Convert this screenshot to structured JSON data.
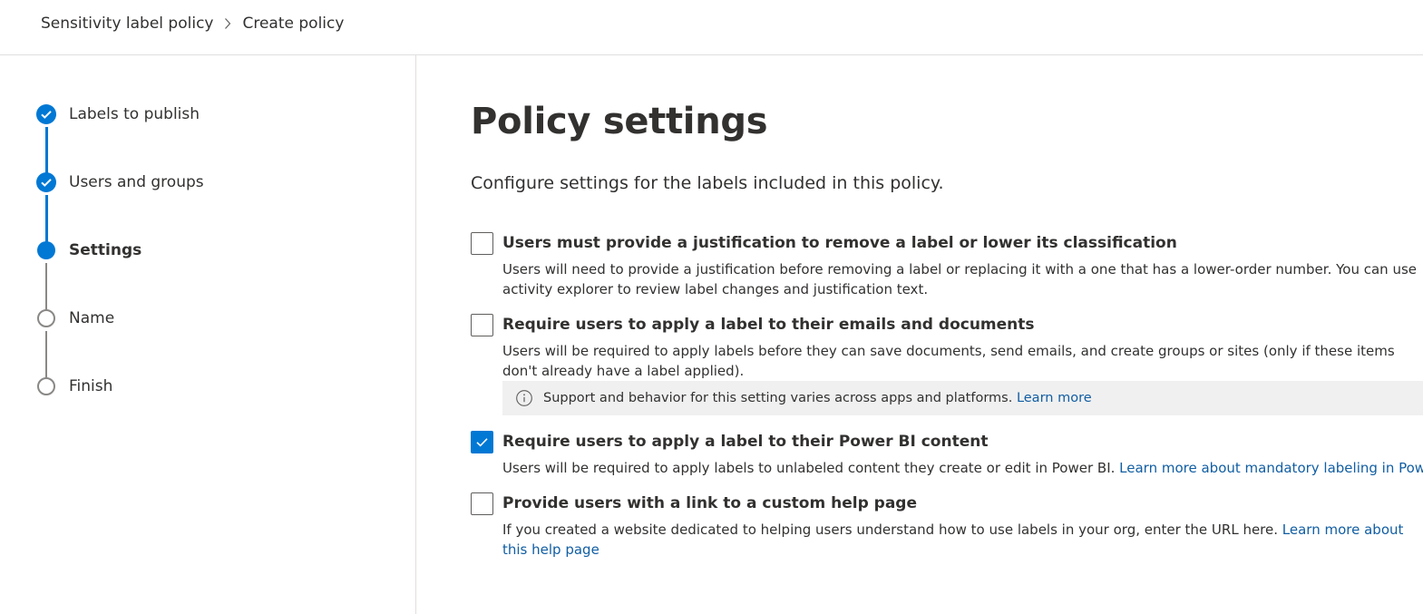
{
  "breadcrumb": {
    "root": "Sensitivity label policy",
    "current": "Create policy"
  },
  "steps": [
    {
      "label": "Labels to publish",
      "status": "completed"
    },
    {
      "label": "Users and groups",
      "status": "completed"
    },
    {
      "label": "Settings",
      "status": "current"
    },
    {
      "label": "Name",
      "status": "not-started"
    },
    {
      "label": "Finish",
      "status": "not-started"
    }
  ],
  "page": {
    "title": "Policy settings",
    "subtitle": "Configure settings for the labels included in this policy."
  },
  "options": [
    {
      "title": "Users must provide a justification to remove a label or lower its classification",
      "description": "Users will need to provide a justification before removing a label or replacing it with a one that has a lower-order number. You can use activity explorer to review label changes and justification text.",
      "checked": false
    },
    {
      "title": "Require users to apply a label to their emails and documents",
      "description": "Users will be required to apply labels before they can save documents, send emails, and create groups or sites (only if these items don't already have a label applied).",
      "checked": false,
      "info": {
        "text": "Support and behavior for this setting varies across apps and platforms.",
        "link": "Learn more"
      }
    },
    {
      "title": "Require users to apply a label to their Power BI content",
      "description": "Users will be required to apply labels to unlabeled content they create or edit in Power BI.",
      "link": "Learn more about mandatory labeling in Power BI",
      "checked": true
    },
    {
      "title": "Provide users with a link to a custom help page",
      "description": "If you created a website dedicated to helping users understand how to use labels in your org, enter the URL here.",
      "link": "Learn more about this help page",
      "checked": false
    }
  ],
  "colors": {
    "accent": "#0078d4",
    "link": "#115ea3",
    "text": "#323130",
    "border": "#e1dfdd",
    "info_background": "#f0f0f0",
    "pending_step": "#8a8886"
  }
}
